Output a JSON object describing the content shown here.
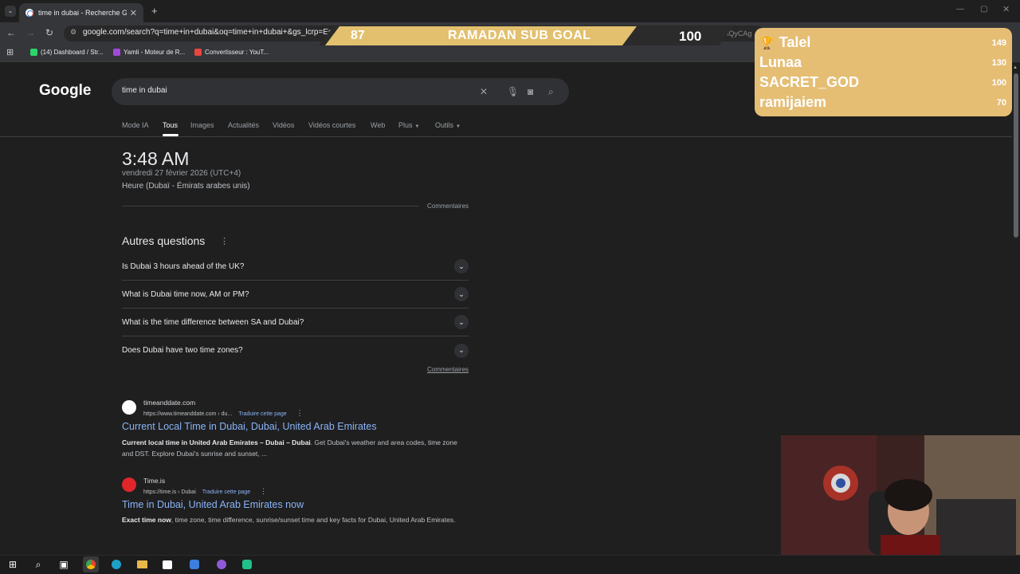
{
  "browser": {
    "tab_title": "time in dubai - Recherche Google",
    "tab_close": "✕",
    "new_tab": "+",
    "url": "google.com/search?q=time+in+dubai&oq=time+in+dubai+&gs_lcrp=EgZ",
    "url_tail": "EAAYgAQyCAg",
    "bookmarks": [
      {
        "label": "(14) Dashboard / Str...",
        "color": "#2bd66a"
      },
      {
        "label": "Yamli - Moteur de R...",
        "color": "#a34ad8"
      },
      {
        "label": "Convertisseur : YouT...",
        "color": "#e8453c"
      }
    ]
  },
  "overlay": {
    "goal_current": "87",
    "goal_title": "RAMADAN SUB GOAL",
    "goal_target": "100",
    "goal_progress": 0.87,
    "leaderboard": [
      {
        "name": "Talel",
        "value": "149"
      },
      {
        "name": "Lunaa",
        "value": "130"
      },
      {
        "name": "SACRET_GOD",
        "value": "100"
      },
      {
        "name": "ramijaiem",
        "value": "70"
      }
    ]
  },
  "google": {
    "logo": "Google",
    "query": "time in dubai",
    "tabs": [
      "Mode IA",
      "Tous",
      "Images",
      "Actualités",
      "Vidéos",
      "Vidéos courtes",
      "Web",
      "Plus",
      "Outils"
    ],
    "active_tab": "Tous",
    "time": "3:48 AM",
    "date": "vendredi 27 février 2026 (UTC+4)",
    "tz": "Heure (Dubaï - Émirats arabes unis)",
    "comments": "Commentaires",
    "paa_title": "Autres questions",
    "questions": [
      "Is Dubai 3 hours ahead of the UK?",
      "What is Dubai time now, AM or PM?",
      "What is the time difference between SA and Dubai?",
      "Does Dubai have two time zones?"
    ],
    "results": [
      {
        "site": "timeanddate.com",
        "url": "https://www.timeanddate.com › du...",
        "translate": "Traduire cette page",
        "title": "Current Local Time in Dubai, Dubai, United Arab Emirates",
        "snippet_bold": "Current local time in United Arab Emirates – Dubai – Dubai",
        "snippet": ". Get Dubai's weather and area codes, time zone and DST. Explore Dubai's sunrise and sunset, ..."
      },
      {
        "site": "Time.is",
        "url": "https://time.is › Dubai",
        "translate": "Traduire cette page",
        "title": "Time in Dubai, United Arab Emirates now",
        "snippet_bold": "Exact time now",
        "snippet": ", time zone, time difference, sunrise/sunset time and key facts for Dubai, United Arab Emirates."
      }
    ]
  }
}
